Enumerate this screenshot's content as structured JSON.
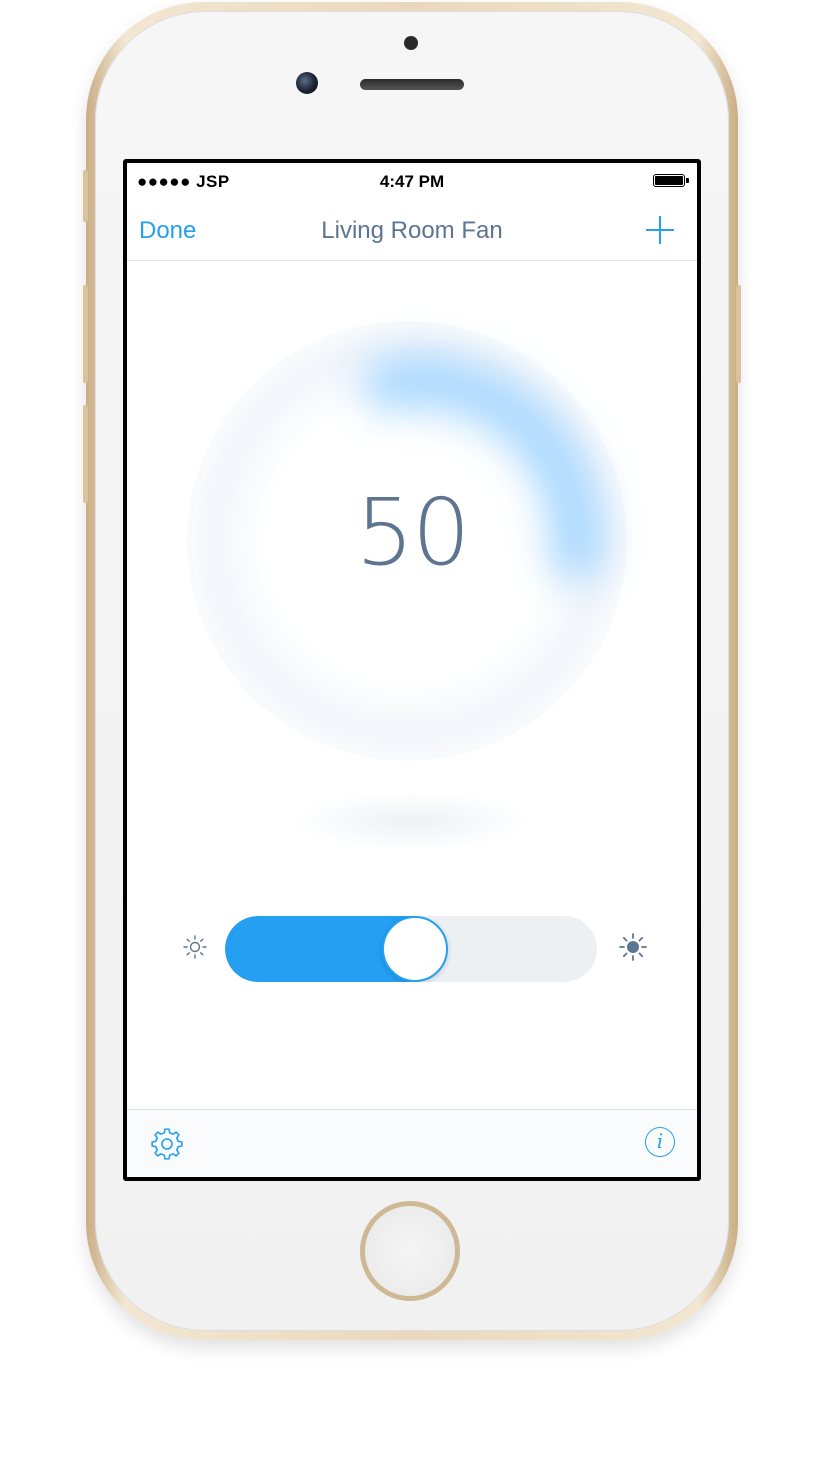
{
  "status_bar": {
    "signal": "●●●●●",
    "carrier": "JSP",
    "time": "4:47 PM"
  },
  "nav": {
    "done_label": "Done",
    "title": "Living Room Fan",
    "add_icon": "plus-icon"
  },
  "dial": {
    "value": "50",
    "level": 0.5
  },
  "slider": {
    "value_fraction": 0.5,
    "min_icon": "sun-small-icon",
    "max_icon": "sun-large-icon"
  },
  "toolbar": {
    "settings_icon": "gear-icon",
    "info_label": "i"
  },
  "colors": {
    "accent": "#249ff2",
    "title": "#5e7591",
    "track": "#edf0f3"
  }
}
